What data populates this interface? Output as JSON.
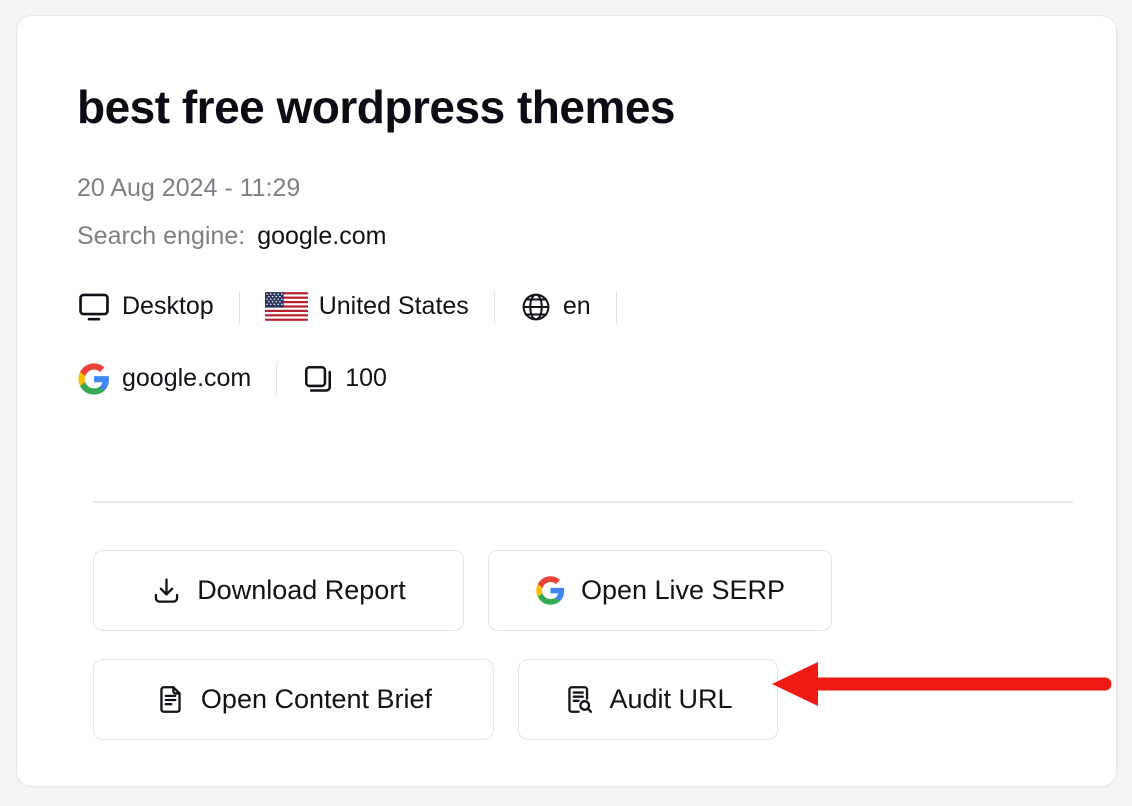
{
  "card": {
    "title": "best free wordpress themes",
    "date": "20 Aug 2024 - 11:29",
    "search_engine": {
      "label": "Search engine:",
      "value": "google.com"
    },
    "meta": {
      "row1": [
        {
          "icon": "monitor-icon",
          "text": "Desktop"
        },
        {
          "icon": "flag-us-icon",
          "text": "United States"
        },
        {
          "icon": "globe-icon",
          "text": "en"
        }
      ],
      "row2": [
        {
          "icon": "google-icon",
          "text": "google.com"
        },
        {
          "icon": "pages-icon",
          "text": "100"
        }
      ]
    },
    "buttons": [
      {
        "id": "download",
        "icon": "download-icon",
        "label": "Download Report"
      },
      {
        "id": "live-serp",
        "icon": "google-icon",
        "label": "Open Live SERP"
      },
      {
        "id": "content-brief",
        "icon": "document-icon",
        "label": "Open Content Brief"
      },
      {
        "id": "audit-url",
        "icon": "document-search-icon",
        "label": "Audit URL"
      }
    ]
  },
  "annotation": {
    "type": "arrow-left",
    "color": "#ee1b12",
    "points_to": "Audit URL"
  },
  "colors": {
    "page_background": "#f5f5f5",
    "card_background": "#ffffff",
    "card_border": "#e8e8e8",
    "title_text": "#0b0c15",
    "muted_text": "#7c7f8a",
    "body_text": "#12131a",
    "divider": "#e6e7e9",
    "annotation_red": "#ee1b12"
  }
}
